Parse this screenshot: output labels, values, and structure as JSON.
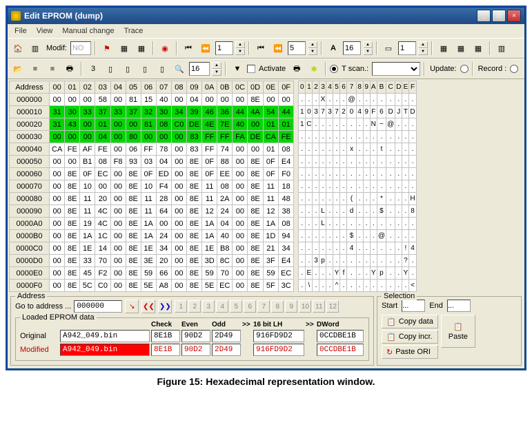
{
  "window": {
    "title": "Edit EPROM (dump)"
  },
  "menu": [
    "File",
    "View",
    "Manual change",
    "Trace"
  ],
  "toolbar1": {
    "modif_label": "Modif:",
    "modif_value": "NO",
    "spin1": "1",
    "spin2": "5",
    "spin3": "16",
    "spin4": "1"
  },
  "toolbar2": {
    "search": "16",
    "activate": "Activate",
    "tscan": "T scan.:",
    "update": "Update:",
    "record": "Record :"
  },
  "hex": {
    "cols": [
      "00",
      "01",
      "02",
      "03",
      "04",
      "05",
      "06",
      "07",
      "08",
      "09",
      "0A",
      "0B",
      "0C",
      "0D",
      "0E",
      "0F"
    ],
    "addr_header": "Address",
    "rows": [
      {
        "a": "000000",
        "hl": false,
        "c": [
          "00",
          "00",
          "00",
          "58",
          "00",
          "81",
          "15",
          "40",
          "00",
          "04",
          "00",
          "00",
          "00",
          "8E",
          "00",
          "00"
        ]
      },
      {
        "a": "000010",
        "hl": true,
        "c": [
          "31",
          "30",
          "33",
          "37",
          "33",
          "37",
          "32",
          "30",
          "34",
          "39",
          "46",
          "36",
          "44",
          "4A",
          "54",
          "44"
        ]
      },
      {
        "a": "000020",
        "hl": true,
        "c": [
          "31",
          "43",
          "00",
          "01",
          "00",
          "00",
          "81",
          "08",
          "C0",
          "DE",
          "4E",
          "7E",
          "40",
          "00",
          "01",
          "01"
        ]
      },
      {
        "a": "000030",
        "hl": true,
        "c": [
          "00",
          "00",
          "00",
          "04",
          "00",
          "80",
          "00",
          "00",
          "00",
          "83",
          "FF",
          "FF",
          "FA",
          "DE",
          "CA",
          "FE"
        ]
      },
      {
        "a": "000040",
        "hl": false,
        "c": [
          "CA",
          "FE",
          "AF",
          "FE",
          "00",
          "06",
          "FF",
          "78",
          "00",
          "83",
          "FF",
          "74",
          "00",
          "00",
          "01",
          "08"
        ]
      },
      {
        "a": "000050",
        "hl": false,
        "c": [
          "00",
          "00",
          "B1",
          "08",
          "F8",
          "93",
          "03",
          "04",
          "00",
          "8E",
          "0F",
          "88",
          "00",
          "8E",
          "0F",
          "E4"
        ]
      },
      {
        "a": "000060",
        "hl": false,
        "c": [
          "00",
          "8E",
          "0F",
          "EC",
          "00",
          "8E",
          "0F",
          "ED",
          "00",
          "8E",
          "0F",
          "EE",
          "00",
          "8E",
          "0F",
          "F0"
        ]
      },
      {
        "a": "000070",
        "hl": false,
        "c": [
          "00",
          "8E",
          "10",
          "00",
          "00",
          "8E",
          "10",
          "F4",
          "00",
          "8E",
          "11",
          "08",
          "00",
          "8E",
          "11",
          "18"
        ]
      },
      {
        "a": "000080",
        "hl": false,
        "c": [
          "00",
          "8E",
          "11",
          "20",
          "00",
          "8E",
          "11",
          "28",
          "00",
          "8E",
          "11",
          "2A",
          "00",
          "8E",
          "11",
          "48"
        ]
      },
      {
        "a": "000090",
        "hl": false,
        "c": [
          "00",
          "8E",
          "11",
          "4C",
          "00",
          "8E",
          "11",
          "64",
          "00",
          "8E",
          "12",
          "24",
          "00",
          "8E",
          "12",
          "38"
        ]
      },
      {
        "a": "0000A0",
        "hl": false,
        "c": [
          "00",
          "8E",
          "19",
          "4C",
          "00",
          "8E",
          "1A",
          "00",
          "00",
          "8E",
          "1A",
          "04",
          "00",
          "8E",
          "1A",
          "08"
        ]
      },
      {
        "a": "0000B0",
        "hl": false,
        "c": [
          "00",
          "8E",
          "1A",
          "1C",
          "00",
          "8E",
          "1A",
          "24",
          "00",
          "8E",
          "1A",
          "40",
          "00",
          "8E",
          "1D",
          "94"
        ]
      },
      {
        "a": "0000C0",
        "hl": false,
        "c": [
          "00",
          "8E",
          "1E",
          "14",
          "00",
          "8E",
          "1E",
          "34",
          "00",
          "8E",
          "1E",
          "B8",
          "00",
          "8E",
          "21",
          "34"
        ]
      },
      {
        "a": "0000D0",
        "hl": false,
        "c": [
          "00",
          "8E",
          "33",
          "70",
          "00",
          "8E",
          "3E",
          "20",
          "00",
          "8E",
          "3D",
          "8C",
          "00",
          "8E",
          "3F",
          "E4"
        ]
      },
      {
        "a": "0000E0",
        "hl": false,
        "c": [
          "00",
          "8E",
          "45",
          "F2",
          "00",
          "8E",
          "59",
          "66",
          "00",
          "8E",
          "59",
          "70",
          "00",
          "8E",
          "59",
          "EC"
        ]
      },
      {
        "a": "0000F0",
        "hl": false,
        "c": [
          "00",
          "8E",
          "5C",
          "C0",
          "00",
          "8E",
          "5E",
          "A8",
          "00",
          "8E",
          "5E",
          "EC",
          "00",
          "8E",
          "5F",
          "3C"
        ]
      }
    ]
  },
  "ascii": {
    "cols": [
      "0",
      "1",
      "2",
      "3",
      "4",
      "5",
      "6",
      "7",
      "8",
      "9",
      "A",
      "B",
      "C",
      "D",
      "E",
      "F"
    ],
    "rows": [
      [
        ".",
        ".",
        ".",
        "X",
        ".",
        ".",
        ".",
        "@",
        ".",
        ".",
        ".",
        ".",
        ".",
        ".",
        ".",
        "."
      ],
      [
        "1",
        "0",
        "3",
        "7",
        "3",
        "7",
        "2",
        "0",
        "4",
        "9",
        "F",
        "6",
        "D",
        "J",
        "T",
        "D"
      ],
      [
        "1",
        "C",
        ".",
        ".",
        ".",
        ".",
        ".",
        ".",
        ".",
        ".",
        "N",
        "~",
        "@",
        ".",
        ".",
        "."
      ],
      [
        ".",
        ".",
        ".",
        ".",
        ".",
        ".",
        ".",
        ".",
        ".",
        ".",
        ".",
        ".",
        ".",
        ".",
        ".",
        "."
      ],
      [
        ".",
        ".",
        ".",
        ".",
        ".",
        ".",
        ".",
        "x",
        ".",
        ".",
        ".",
        "t",
        ".",
        ".",
        ".",
        "."
      ],
      [
        ".",
        ".",
        ".",
        ".",
        ".",
        ".",
        ".",
        ".",
        ".",
        ".",
        ".",
        ".",
        ".",
        ".",
        ".",
        "."
      ],
      [
        ".",
        ".",
        ".",
        ".",
        ".",
        ".",
        ".",
        ".",
        ".",
        ".",
        ".",
        ".",
        ".",
        ".",
        ".",
        "."
      ],
      [
        ".",
        ".",
        ".",
        ".",
        ".",
        ".",
        ".",
        ".",
        ".",
        ".",
        ".",
        ".",
        ".",
        ".",
        ".",
        "."
      ],
      [
        ".",
        ".",
        ".",
        ".",
        ".",
        ".",
        ".",
        "(",
        ".",
        ".",
        ".",
        "*",
        ".",
        ".",
        ".",
        "H"
      ],
      [
        ".",
        ".",
        ".",
        "L",
        ".",
        ".",
        ".",
        "d",
        ".",
        ".",
        ".",
        "$",
        ".",
        ".",
        ".",
        "8"
      ],
      [
        ".",
        ".",
        ".",
        "L",
        ".",
        ".",
        ".",
        ".",
        ".",
        ".",
        ".",
        ".",
        ".",
        ".",
        ".",
        "."
      ],
      [
        ".",
        ".",
        ".",
        ".",
        ".",
        ".",
        ".",
        "$",
        ".",
        ".",
        ".",
        "@",
        ".",
        ".",
        ".",
        "."
      ],
      [
        ".",
        ".",
        ".",
        ".",
        ".",
        ".",
        ".",
        "4",
        ".",
        ".",
        ".",
        ".",
        ".",
        ".",
        "!",
        "4"
      ],
      [
        ".",
        ".",
        "3",
        "p",
        ".",
        ".",
        ".",
        ".",
        ".",
        ".",
        ".",
        ".",
        ".",
        ".",
        "?",
        "."
      ],
      [
        ".",
        "E",
        ".",
        ".",
        ".",
        "Y",
        "f",
        ".",
        ".",
        ".",
        "Y",
        "p",
        ".",
        ".",
        "Y",
        "."
      ],
      [
        ".",
        "\\",
        ".",
        ".",
        ".",
        "^",
        ".",
        ".",
        ".",
        ".",
        ".",
        ".",
        ".",
        ".",
        ".",
        "<"
      ]
    ]
  },
  "address": {
    "legend": "Address",
    "goto": "Go to address ...",
    "value": "000000",
    "nums": [
      "1",
      "2",
      "3",
      "4",
      "5",
      "6",
      "7",
      "8",
      "9",
      "10",
      "11",
      "12"
    ],
    "loaded": "Loaded EPROM data",
    "headers": {
      "check": "Check",
      "even": "Even",
      "odd": "Odd",
      "bit16": "16 bit LH",
      "dword": "DWord",
      "arrow": ">>"
    },
    "original": {
      "label": "Original",
      "file": "A942_049.bin",
      "check": "8E1B",
      "even": "90D2",
      "odd": "2D49",
      "bit16": "916FD9D2",
      "dword": "0CCDBE1B"
    },
    "modified": {
      "label": "Modified",
      "file": "A942_049.bin",
      "check": "8E1B",
      "even": "90D2",
      "odd": "2D49",
      "bit16": "916FD9D2",
      "dword": "0CCDBE1B"
    }
  },
  "selection": {
    "legend": "Selection",
    "start": "Start",
    "end": "End",
    "startv": "...",
    "endv": "...",
    "copy_data": "Copy data",
    "copy_incr": "Copy incr.",
    "paste_ori": "Paste ORI",
    "paste": "Paste"
  },
  "caption": "Figure 15: Hexadecimal representation window."
}
